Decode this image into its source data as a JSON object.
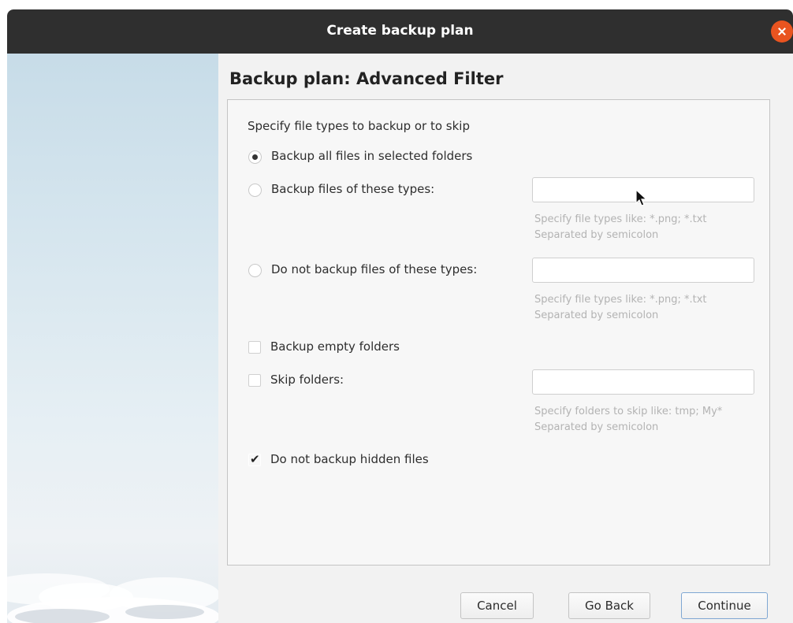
{
  "window": {
    "title": "Create backup plan"
  },
  "page": {
    "heading": "Backup plan: Advanced Filter"
  },
  "filter": {
    "section_label": "Specify file types to backup or to skip",
    "options": {
      "all_files": {
        "label": "Backup all files in selected folders",
        "selected": true
      },
      "these_types": {
        "label": "Backup files of these types:",
        "selected": false,
        "value": "",
        "hint_line1": "Specify file types like: *.png; *.txt",
        "hint_line2": "Separated by semicolon"
      },
      "not_these_types": {
        "label": "Do not backup files of these types:",
        "selected": false,
        "value": "",
        "hint_line1": "Specify file types like: *.png; *.txt",
        "hint_line2": "Separated by semicolon"
      }
    },
    "backup_empty_folders": {
      "label": "Backup empty folders",
      "checked": false
    },
    "skip_folders": {
      "label": "Skip folders:",
      "checked": false,
      "value": "",
      "hint_line1": "Specify folders to skip like: tmp; My*",
      "hint_line2": "Separated by semicolon"
    },
    "skip_hidden": {
      "label": "Do not backup hidden files",
      "checked": true,
      "mark": "✔"
    }
  },
  "buttons": {
    "cancel": "Cancel",
    "go_back": "Go Back",
    "continue": "Continue"
  },
  "icons": {
    "close": "close-icon",
    "cursor": "mouse-pointer-icon"
  },
  "colors": {
    "titlebar": "#2f2f2f",
    "close_button": "#e95420",
    "default_button_border": "#7fa7d3"
  }
}
